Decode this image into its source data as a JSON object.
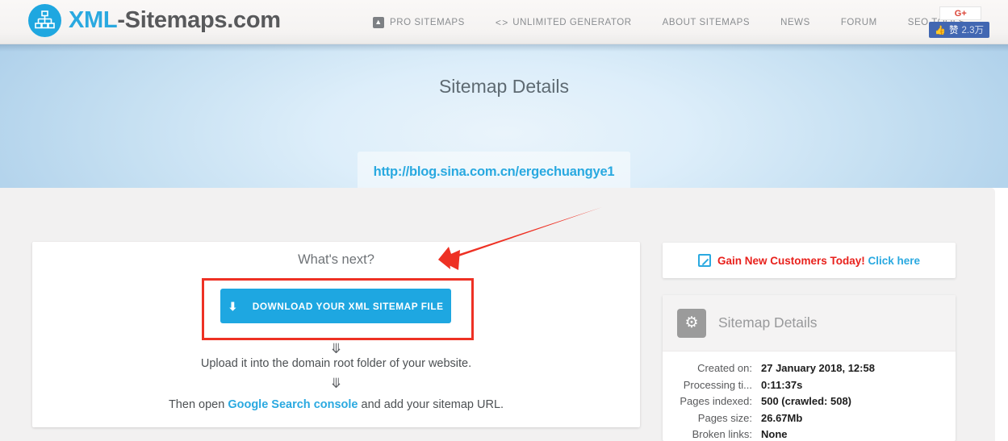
{
  "header": {
    "logo": {
      "primary": "XML",
      "secondary": "-Sitemaps.com",
      "icon": "sitemap-tree-icon"
    },
    "nav": [
      {
        "label": "PRO SITEMAPS",
        "icon": "pro-box-icon"
      },
      {
        "label": "UNLIMITED GENERATOR",
        "icon": "code-brackets-icon"
      },
      {
        "label": "ABOUT SITEMAPS",
        "icon": ""
      },
      {
        "label": "NEWS",
        "icon": ""
      },
      {
        "label": "FORUM",
        "icon": ""
      },
      {
        "label": "SEO TOOLS",
        "icon": ""
      }
    ],
    "social": {
      "gplus_label": "G+",
      "facebook_like_label": "赞",
      "facebook_like_count": "2.3万",
      "thumb_icon": "thumbs-up-icon"
    }
  },
  "hero": {
    "title": "Sitemap Details",
    "url": "http://blog.sina.com.cn/ergechuangye1"
  },
  "main": {
    "whats_next_title": "What's next?",
    "download_button_label": "DOWNLOAD YOUR XML SITEMAP FILE",
    "download_icon": "download-arrow-icon",
    "step_one": "Upload it into the domain root folder of your website.",
    "step_two_prefix": "Then open ",
    "step_two_link": "Google Search console",
    "step_two_suffix": " and add your sitemap URL.",
    "chevron_icon": "chevron-down-icon"
  },
  "sidebar": {
    "banner": {
      "icon": "external-link-icon",
      "text_red": "Gain New Customers Today!",
      "text_blue": "Click here"
    },
    "panel": {
      "title": "Sitemap Details",
      "icon": "gear-icon",
      "rows": [
        {
          "label": "Created on:",
          "value": "27 January 2018, 12:58"
        },
        {
          "label": "Processing ti...",
          "value": "0:11:37s"
        },
        {
          "label": "Pages indexed:",
          "value": "500 (crawled: 508)"
        },
        {
          "label": "Pages size:",
          "value": "26.67Mb"
        },
        {
          "label": "Broken links:",
          "value": "None"
        }
      ]
    }
  },
  "annotations": {
    "arrow_color": "#ee3124",
    "highlight_color": "#ee3124"
  },
  "colors": {
    "brand_blue": "#2aa9e0",
    "button_blue": "#1ea7e1",
    "red": "#ee3124",
    "facebook_blue": "#4267b2"
  }
}
